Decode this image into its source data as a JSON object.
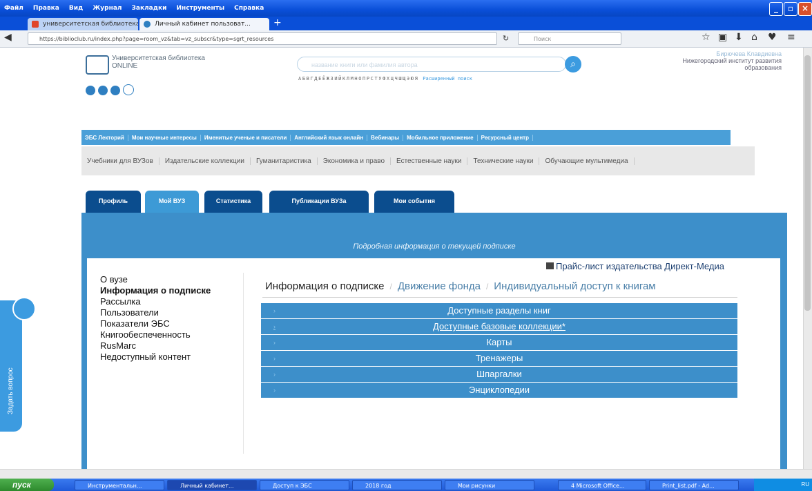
{
  "window": {
    "menu": [
      "Файл",
      "Правка",
      "Вид",
      "Журнал",
      "Закладки",
      "Инструменты",
      "Справка"
    ],
    "controls": [
      "_",
      "▫",
      "×"
    ]
  },
  "browser_tabs": [
    {
      "label": "университетская библиотека",
      "active": false
    },
    {
      "label": "Личный кабинет пользоват...",
      "active": true
    }
  ],
  "address": {
    "url_host": "biblioclub.ru",
    "url": "https://biblioclub.ru/index.php?page=room_vz&tab=vz_subscr&type=sgrt_resources",
    "search_placeholder": "Поиск"
  },
  "site": {
    "logo_line1": "Университетская библиотека",
    "logo_line2": "ONLINE",
    "search_placeholder": "название книги или фамилия автора",
    "alphabet": "АБВГДЕЁЖЗИЙКЛМНОПРСТУФХЦЧШЩЭЮЯ",
    "advanced_search": "Расширенный поиск",
    "user_name": "Бирючева Клавдиевна",
    "user_org_line1": "Нижегородский институт развития",
    "user_org_line2": "образования"
  },
  "main_nav": [
    "ЭБС Лекторий",
    "Мои научные интересы",
    "Именитые ученые и писатели",
    "Английский язык онлайн",
    "Вебинары",
    "Мобильное приложение",
    "Ресурсный центр"
  ],
  "sub_nav": [
    "Учебники для ВУЗов",
    "Издательские коллекции",
    "Гуманитаристика",
    "Экономика и право",
    "Естественные науки",
    "Технические науки",
    "Обучающие мультимедиа"
  ],
  "cabinet_tabs": [
    {
      "label": "Профиль",
      "active": false
    },
    {
      "label": "Мой ВУЗ",
      "active": true
    },
    {
      "label": "Статистика",
      "active": false
    },
    {
      "label": "Публикации ВУЗа",
      "active": false
    },
    {
      "label": "Мои события",
      "active": false
    }
  ],
  "panel_header": "Подробная информация о текущей подписке",
  "left_menu": [
    {
      "label": "О вузе",
      "bold": false
    },
    {
      "label": "Информация о подписке",
      "bold": true
    },
    {
      "label": "Рассылка",
      "bold": false
    },
    {
      "label": "Пользователи",
      "bold": false
    },
    {
      "label": "Показатели ЭБС",
      "bold": false
    },
    {
      "label": "Книгообеспеченность",
      "bold": false
    },
    {
      "label": "RusMarc",
      "bold": false
    },
    {
      "label": "Недоступный контент",
      "bold": false
    }
  ],
  "price_link": "Прайс-лист издательства Директ-Медиа",
  "info_tabs": {
    "active": "Информация о подписке",
    "tab2": "Движение фонда",
    "tab3": "Индивидуальный доступ к книгам"
  },
  "sections": [
    {
      "label": "Доступные разделы книг",
      "underline": false
    },
    {
      "label": "Доступные базовые коллекции*",
      "underline": true
    },
    {
      "label": "Карты",
      "underline": false
    },
    {
      "label": "Тренажеры",
      "underline": false
    },
    {
      "label": "Шпаргалки",
      "underline": false
    },
    {
      "label": "Энциклопедии",
      "underline": false
    }
  ],
  "ask_question": "Задать вопрос",
  "taskbar": {
    "start": "пуск",
    "tasks": [
      "Инструментальн...",
      "Личный кабинет...",
      "Доступ к ЭБС",
      "2018 год",
      "Мои рисунки",
      "4 Microsoft Office...",
      "Print_list.pdf - Ad..."
    ],
    "tray": "RU"
  },
  "colors": {
    "accent": "#3d8fca",
    "dark_tab": "#0b4d8e",
    "xp_blue": "#0a4fd8"
  }
}
